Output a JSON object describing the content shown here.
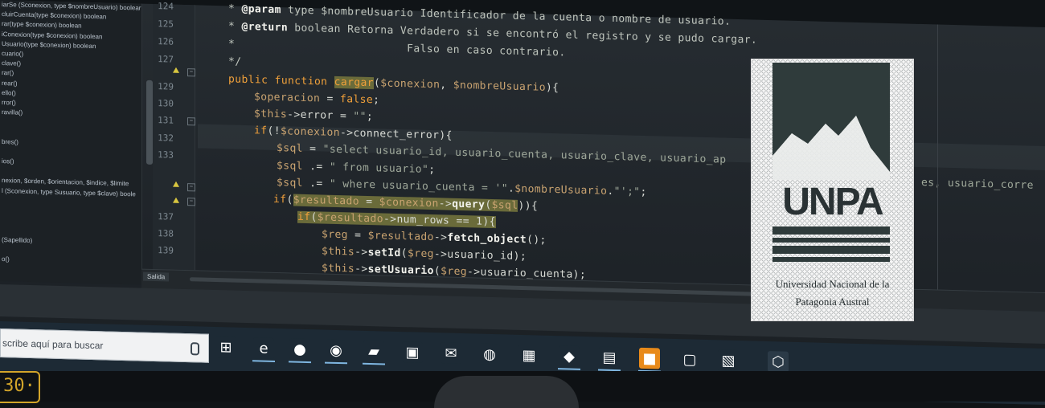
{
  "navigator": {
    "items": [
      "iarSe (Sconexion, type $nombreUsuario) boolear",
      "cluirCuenta(type $conexion) boolean",
      "rar(type $conexion) boolean",
      "iConexion(type $conexion) boolean",
      "Usuario(type $conexion) boolean",
      "cuario()",
      "clave()",
      "rar()",
      "rear()",
      "ello()",
      "rror()",
      "ravilla()",
      "",
      "",
      "bres()",
      "",
      "ios()",
      "",
      "nexion, $orden, $orientacion, $indice, $limite",
      "l (Sconexion, type Susuario, type $clave) boole",
      "",
      "",
      "",
      "",
      "(Sapellido)",
      "",
      "o()"
    ]
  },
  "gutter": {
    "line_numbers": [
      "124",
      "125",
      "126",
      "127",
      "",
      "129",
      "130",
      "131",
      "132",
      "133",
      "",
      "",
      "137",
      "138",
      "139"
    ]
  },
  "code": {
    "lines": {
      "l0a": "* ",
      "l0b": "@param",
      "l0c": " type $nombreUsuario Identificador de la cuenta o nombre de usuario.",
      "l1a": "* ",
      "l1b": "@return",
      "l1c": " boolean Retorna Verdadero si se encontró el registro y se pudo cargar.",
      "l2": "*                          Falso en caso contrario.",
      "l3": "*/",
      "l4a": "public function ",
      "l4b": "cargar",
      "l4c": "(",
      "l4d": "$conexion",
      "l4e": ", ",
      "l4f": "$nombreUsuario",
      "l4g": "){",
      "l5a": "$operacion",
      "l5b": " = ",
      "l5c": "false",
      "l5d": ";",
      "l6a": "$this",
      "l6b": "->error = ",
      "l6c": "\"\"",
      "l6d": ";",
      "l7a": "if",
      "l7b": "(!",
      "l7c": "$conexion",
      "l7d": "->connect_error){",
      "l8a": "$sql",
      "l8b": " = ",
      "l8c": "\"select usuario_id, usuario_cuenta, usuario_clave, usuario_ap",
      "l8d": "es, usuario_corre",
      "l9a": "$sql",
      "l9b": " .= ",
      "l9c": "\" from usuario\"",
      "l9d": ";",
      "l10a": "$sql",
      "l10b": " .= ",
      "l10c": "\" where usuario_cuenta = '\"",
      "l10d": ".",
      "l10e": "$nombreUsuario",
      "l10f": ".",
      "l10g": "\"';\"",
      "l10h": ";",
      "l11a": "if",
      "l11b": "(",
      "l11c": "$resultado",
      "l11d": " = ",
      "l11e": "$conexion",
      "l11f": "->",
      "l11g": "query",
      "l11h": "(",
      "l11i": "$sql",
      "l11j": ")){",
      "l12a": "if",
      "l12b": "(",
      "l12c": "$resultado",
      "l12d": "->num_rows == 1){",
      "l13a": "$reg",
      "l13b": " = ",
      "l13c": "$resultado",
      "l13d": "->",
      "l13e": "fetch_object",
      "l13f": "();",
      "l14a": "$this",
      "l14b": "->",
      "l14c": "setId",
      "l14d": "(",
      "l14e": "$reg",
      "l14f": "->usuario_id);",
      "l15a": "$this",
      "l15b": "->",
      "l15c": "setUsuario",
      "l15d": "(",
      "l15e": "$reg",
      "l15f": "->usuario_cuenta);"
    }
  },
  "output": {
    "tab_label": "Salida"
  },
  "taskbar": {
    "search_placeholder": "scribe aquí para buscar",
    "icons": [
      {
        "name": "task-view-icon",
        "glyph": "⊞",
        "color": "#1d2a35"
      },
      {
        "name": "edge-icon",
        "glyph": "e",
        "color": "#1d2a35"
      },
      {
        "name": "chrome-icon",
        "glyph": "●",
        "color": "#1d2a35"
      },
      {
        "name": "firefox-icon",
        "glyph": "◉",
        "color": "#1d2a35"
      },
      {
        "name": "file-explorer-icon",
        "glyph": "▰",
        "color": "#1d2a35"
      },
      {
        "name": "store-icon",
        "glyph": "▣",
        "color": "#1d2a35"
      },
      {
        "name": "mail-icon",
        "glyph": "✉",
        "color": "#1d2a35"
      },
      {
        "name": "app-icon-1",
        "glyph": "◍",
        "color": "#1d2a35"
      },
      {
        "name": "calculator-icon",
        "glyph": "▦",
        "color": "#1d2a35"
      },
      {
        "name": "app-icon-2",
        "glyph": "◆",
        "color": "#1d2a35"
      },
      {
        "name": "app-icon-3",
        "glyph": "▤",
        "color": "#1d2a35"
      },
      {
        "name": "app-icon-4",
        "glyph": "■",
        "color": "#e88a1a"
      },
      {
        "name": "app-icon-5",
        "glyph": "▢",
        "color": "#1d2a35"
      },
      {
        "name": "app-icon-6",
        "glyph": "▧",
        "color": "#1d2a35"
      },
      {
        "name": "shield-icon",
        "glyph": "⬡",
        "color": "#2b3a47"
      }
    ]
  },
  "monitor_badge": "30·",
  "logo": {
    "acronym": "UNPA",
    "line1": "Universidad Nacional de la",
    "line2": "Patagonia Austral"
  }
}
